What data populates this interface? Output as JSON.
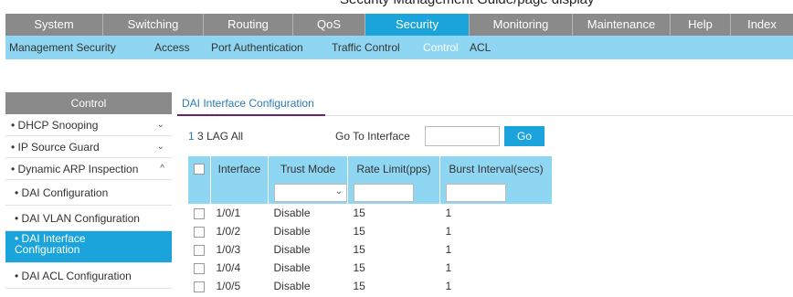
{
  "page_caption": "Security Management Guide/page display",
  "main_nav": [
    "System",
    "Switching",
    "Routing",
    "QoS",
    "Security",
    "Monitoring",
    "Maintenance",
    "Help",
    "Index"
  ],
  "sub_nav": [
    "Management Security",
    "Access",
    "Port Authentication",
    "Traffic Control",
    "Control",
    "ACL"
  ],
  "sidebar": {
    "header": "Control",
    "items": [
      {
        "label": "• DHCP Snooping",
        "chevron": "⌄"
      },
      {
        "label": "• IP Source Guard",
        "chevron": "⌄"
      },
      {
        "label": "• Dynamic ARP Inspection",
        "chevron": "^"
      },
      {
        "label": "• DAI Configuration"
      },
      {
        "label": "• DAI VLAN Configuration"
      },
      {
        "label": "• DAI Interface\nConfiguration"
      },
      {
        "label": "• DAI ACL Configuration"
      }
    ]
  },
  "content": {
    "title": "DAI Interface Configuration",
    "filter_links": [
      "1",
      "3",
      "LAG",
      "All"
    ],
    "goto_label": "Go To Interface",
    "goto_value": "",
    "go_button": "Go"
  },
  "table": {
    "columns": [
      "Interface",
      "Trust Mode",
      "Rate Limit(pps)",
      "Burst Interval(secs)"
    ],
    "rows": [
      {
        "interface": "1/0/1",
        "trust_mode": "Disable",
        "rate_limit": "15",
        "burst_interval": "1"
      },
      {
        "interface": "1/0/2",
        "trust_mode": "Disable",
        "rate_limit": "15",
        "burst_interval": "1"
      },
      {
        "interface": "1/0/3",
        "trust_mode": "Disable",
        "rate_limit": "15",
        "burst_interval": "1"
      },
      {
        "interface": "1/0/4",
        "trust_mode": "Disable",
        "rate_limit": "15",
        "burst_interval": "1"
      },
      {
        "interface": "1/0/5",
        "trust_mode": "Disable",
        "rate_limit": "15",
        "burst_interval": "1"
      }
    ]
  },
  "colors": {
    "accent": "#1ba4dc",
    "subnav": "#8fd6f2",
    "nav_gray": "#8a8a8a",
    "underline": "#6b2070"
  }
}
